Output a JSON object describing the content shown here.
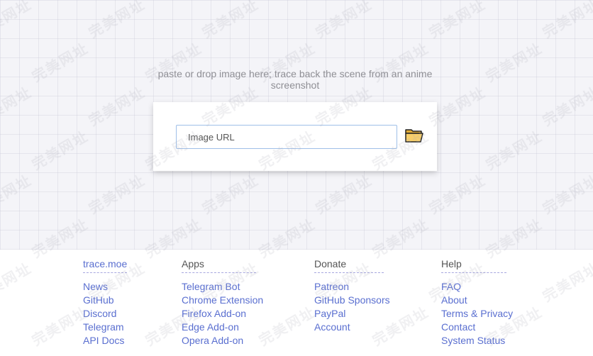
{
  "hero": {
    "hint": "paste or drop image here; trace back the scene from an anime screenshot"
  },
  "search": {
    "placeholder": "Image URL",
    "value": ""
  },
  "icons": {
    "folder": "folder-icon"
  },
  "footer": {
    "brand": {
      "heading": "trace.moe",
      "links": [
        "News",
        "GitHub",
        "Discord",
        "Telegram",
        "API Docs"
      ]
    },
    "apps": {
      "heading": "Apps",
      "links": [
        "Telegram Bot",
        "Chrome Extension",
        "Firefox Add-on",
        "Edge Add-on",
        "Opera Add-on"
      ]
    },
    "donate": {
      "heading": "Donate",
      "links": [
        "Patreon",
        "GitHub Sponsors",
        "PayPal",
        "Account"
      ]
    },
    "help": {
      "heading": "Help",
      "links": [
        "FAQ",
        "About",
        "Terms & Privacy",
        "Contact",
        "System Status"
      ]
    }
  },
  "watermark": {
    "text": "完美网址"
  },
  "colors": {
    "accent": "#5a6fd0",
    "input_border": "#9fbfe8",
    "folder_fill": "#f7cf6b",
    "page_background": "#f4f4f8"
  }
}
